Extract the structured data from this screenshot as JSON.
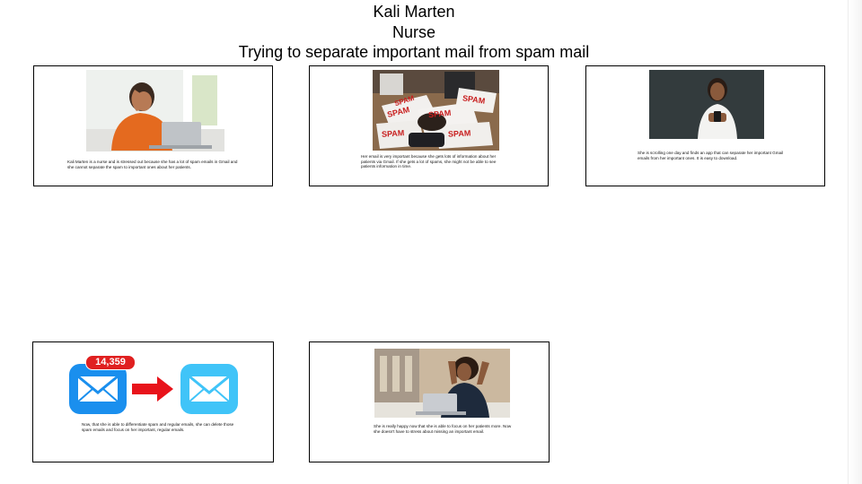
{
  "header": {
    "name": "Kali Marten",
    "role": "Nurse",
    "goal": "Trying to separate important mail from spam mail"
  },
  "panels": [
    {
      "caption": "Kali Marten is a nurse and is stressed out because she has a lot of spam emails in Gmail and she cannot separate the spam to important ones about her patients.",
      "image": "stressed-woman-laptop-photo"
    },
    {
      "caption": "Her email is very important because she gets lots of information about her patients via Gmail. If she gets a lot of spams, she might not be able to see patients information in time.",
      "image": "spam-papers-photo",
      "image_text": [
        "SPAM",
        "SPAM",
        "SPAM",
        "SPAM",
        "SPAM",
        "SPAM"
      ]
    },
    {
      "caption": "She is scrolling one day and finds an app that can separate her important Gmail emails from her important ones. It is easy to download.",
      "image": "woman-phone-photo"
    },
    {
      "caption": "Now, that she is able to differentiate spam and regular emails, she can delete those spam emails and focus on her important, regular emails.",
      "image": "mail-app-icons",
      "badge": "14,359"
    },
    {
      "caption": "She is really happy now that she is able to focus on her patients more. Now she doesn't have to stress about missing an important email.",
      "image": "happy-woman-laptop-photo"
    }
  ],
  "colors": {
    "badge_red": "#e02020",
    "arrow_red": "#e8131b",
    "mail_blue": "#1a8fee",
    "mail_light_blue": "#40c4f8"
  }
}
